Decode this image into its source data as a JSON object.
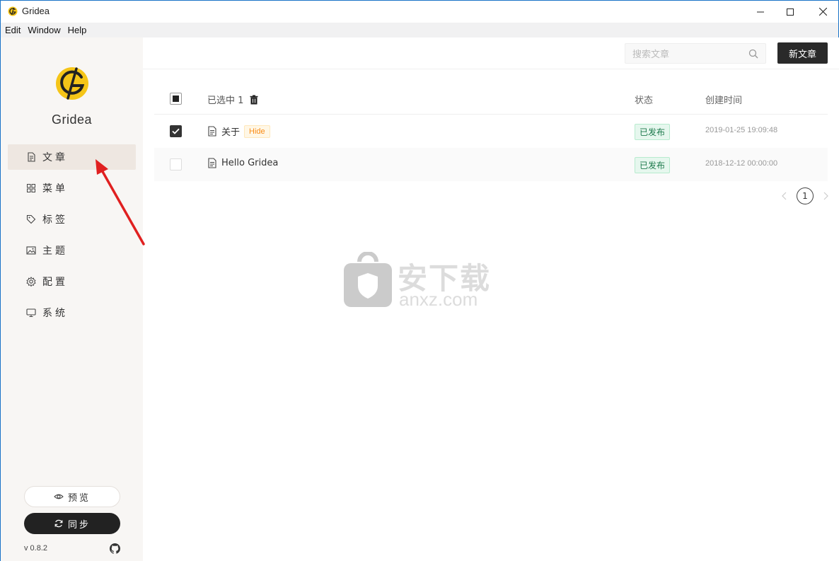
{
  "window": {
    "title": "Gridea",
    "controls": [
      "minimize",
      "maximize",
      "close"
    ]
  },
  "menubar": {
    "items": [
      "Edit",
      "Window",
      "Help"
    ]
  },
  "sidebar": {
    "brand": "Gridea",
    "nav": [
      {
        "label": "文章",
        "icon": "document-icon",
        "active": true
      },
      {
        "label": "菜单",
        "icon": "grid-icon",
        "active": false
      },
      {
        "label": "标签",
        "icon": "tag-icon",
        "active": false
      },
      {
        "label": "主题",
        "icon": "image-icon",
        "active": false
      },
      {
        "label": "配置",
        "icon": "gear-icon",
        "active": false
      },
      {
        "label": "系统",
        "icon": "monitor-icon",
        "active": false
      }
    ],
    "preview_label": "预览",
    "sync_label": "同步",
    "version": "v 0.8.2"
  },
  "topbar": {
    "search_placeholder": "搜索文章",
    "new_post_label": "新文章"
  },
  "table": {
    "header": {
      "selected_label": "已选中 1",
      "status_label": "状态",
      "created_label": "创建时间"
    },
    "rows": [
      {
        "title": "关于",
        "tag": "Hide",
        "status": "已发布",
        "created": "2019-01-25 19:09:48",
        "checked": true
      },
      {
        "title": "Hello Gridea",
        "tag": "",
        "status": "已发布",
        "created": "2018-12-12 00:00:00",
        "checked": false
      }
    ]
  },
  "pagination": {
    "current_page": "1"
  },
  "watermark": {
    "cn": "安下载",
    "en": "anxz.com"
  },
  "colors": {
    "sidebar_bg": "#f8f6f4",
    "active_nav_bg": "#eee7e1",
    "primary_dark": "#2a2a2a",
    "brand_yellow": "#f5c518",
    "status_green": "#1d7a4c",
    "tag_orange": "#fa8c16",
    "annotation_red": "#e02020"
  }
}
